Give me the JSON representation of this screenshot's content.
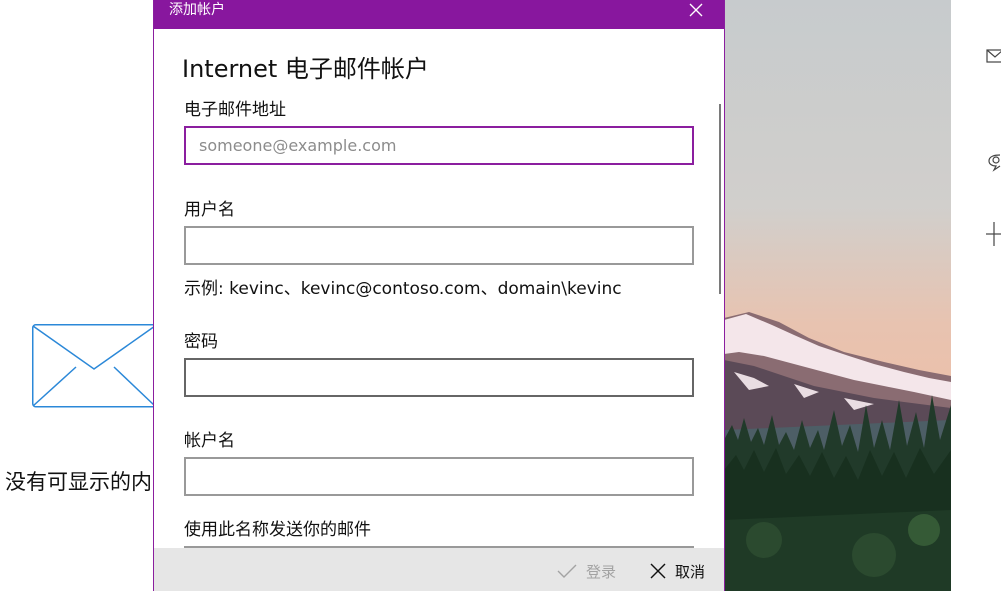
{
  "background": {
    "empty_text": "没有可显示的内"
  },
  "dialog": {
    "title": "添加帐户",
    "heading": "Internet 电子邮件帐户",
    "email": {
      "label": "电子邮件地址",
      "placeholder": "someone@example.com",
      "value": ""
    },
    "username": {
      "label": "用户名",
      "value": "",
      "hint": "示例: kevinc、kevinc@contoso.com、domain\\kevinc"
    },
    "password": {
      "label": "密码",
      "value": ""
    },
    "account_name": {
      "label": "帐户名",
      "value": ""
    },
    "send_name": {
      "label": "使用此名称发送你的邮件"
    },
    "footer": {
      "login_label": "登录",
      "cancel_label": "取消"
    }
  },
  "colors": {
    "accent": "#88179e",
    "footer_bg": "#e6e6e6",
    "disabled_text": "#a3a3a3"
  },
  "icons": [
    "envelope-icon",
    "close-icon",
    "checkmark-icon",
    "mail-icon",
    "chat-icon",
    "plus-icon"
  ]
}
